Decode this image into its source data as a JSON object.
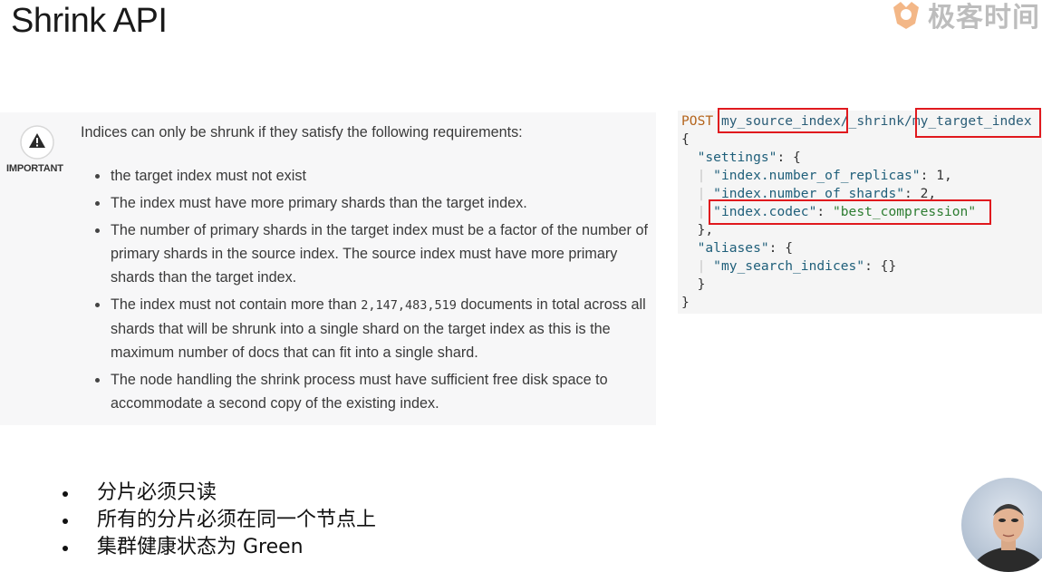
{
  "page": {
    "title": "Shrink API",
    "logo_text": "极客时间"
  },
  "important": {
    "label": "IMPORTANT",
    "intro": "Indices can only be shrunk if they satisfy the following requirements:",
    "items": [
      {
        "text": "the target index must not exist"
      },
      {
        "text": "The index must have more primary shards than the target index."
      },
      {
        "text": "The number of primary shards in the target index must be a factor of the number of primary shards in the source index. The source index must have more primary shards than the target index."
      },
      {
        "before": "The index must not contain more than ",
        "code": "2,147,483,519",
        "after": " documents in total across all shards that will be shrunk into a single shard on the target index as this is the maximum number of docs that can fit into a single shard."
      },
      {
        "text": "The node handling the shrink process must have sufficient free disk space to accommodate a second copy of the existing index."
      }
    ]
  },
  "code": {
    "method": "POST",
    "source_index": "my_source_index",
    "endpoint": "/_shrink/",
    "target_index": "my_target_index",
    "open_brace": "{",
    "settings_key": "\"settings\"",
    "replicas_key": "\"index.number_of_replicas\"",
    "replicas_val": "1",
    "shards_key": "\"index.number_of_shards\"",
    "shards_val": "2",
    "codec_key": "\"index.codec\"",
    "codec_val": "\"best_compression\"",
    "aliases_key": "\"aliases\"",
    "alias_name_key": "\"my_search_indices\"",
    "alias_val": "{}",
    "close_brace": "}"
  },
  "notes": [
    "分片必须只读",
    "所有的分片必须在同一个节点上",
    "集群健康状态为 Green"
  ],
  "colors": {
    "highlight": "#e0191e",
    "panel_bg": "#f7f7f8"
  }
}
